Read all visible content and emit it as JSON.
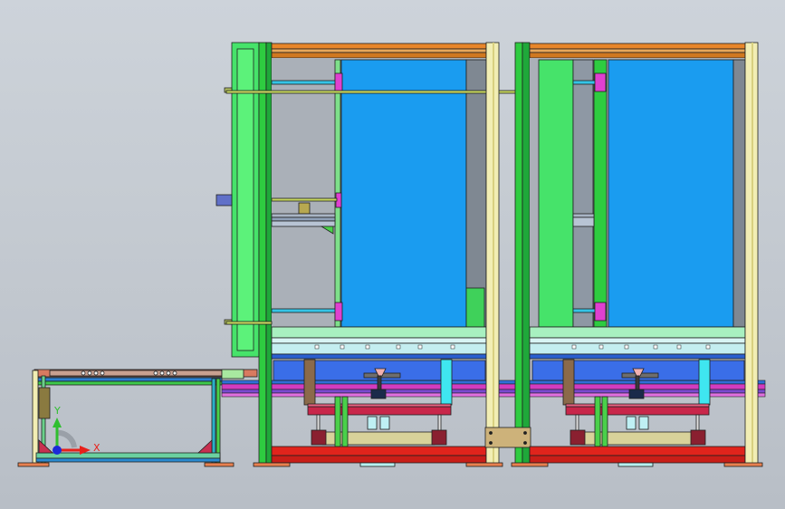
{
  "viewport": {
    "background_top": "#cdd3da",
    "background_bottom": "#b8bec6"
  },
  "triad": {
    "x_label": "X",
    "y_label": "Y",
    "x_color": "#e8201a",
    "y_color": "#2fbf2f",
    "z_color": "#1a2ad8"
  },
  "colors": {
    "outline": "#202020",
    "green_frame": "#2ecc40",
    "light_green": "#5ef07a",
    "cream_post": "#f2eeb4",
    "orange_beam": "#e8862a",
    "panel_blue": "#1a9cf0",
    "magenta_rail": "#d23cc0",
    "crimson_rail": "#c8264a",
    "red_base": "#e0241c",
    "cyan": "#3fe6f0",
    "dark_blue": "#1f4fd8",
    "olive_arm": "#8b6a4a",
    "steel": "#a8b4c4",
    "tan_plate": "#cdb27a"
  }
}
